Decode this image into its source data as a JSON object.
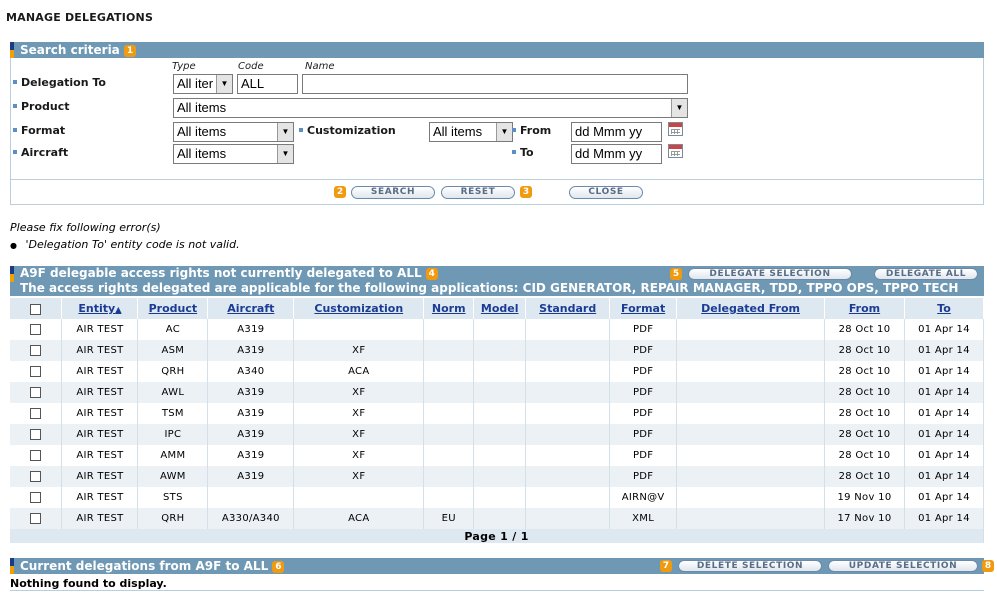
{
  "page": {
    "title": "MANAGE DELEGATIONS"
  },
  "search": {
    "header": "Search criteria",
    "badge": "1",
    "col_type": "Type",
    "col_code": "Code",
    "col_name": "Name",
    "delegation_to_label": "Delegation To",
    "type_value": "All iter",
    "code_value": "ALL",
    "name_value": "",
    "product_label": "Product",
    "product_value": "All items",
    "format_label": "Format",
    "format_value": "All items",
    "customization_label": "Customization",
    "customization_value": "All items",
    "from_label": "From",
    "from_value": "dd Mmm yy",
    "aircraft_label": "Aircraft",
    "aircraft_value": "All items",
    "to_label": "To",
    "to_value": "dd Mmm yy",
    "search_badge": "2",
    "search_button": "SEARCH",
    "reset_button": "RESET",
    "reset_badge": "3",
    "close_button": "CLOSE"
  },
  "errors": {
    "title": "Please fix following error(s)",
    "bullet": "●",
    "items": [
      "'Delegation To' entity code is not valid."
    ]
  },
  "delegable": {
    "header": "A9F delegable access rights not currently delegated to ALL",
    "badge": "4",
    "subheader": "The access rights delegated are applicable for the following applications: CID GENERATOR, REPAIR MANAGER, TDD, TPPO OPS, TPPO TECH",
    "buttons_badge": "5",
    "delegate_selection": "DELEGATE SELECTION",
    "delegate_all": "DELEGATE ALL",
    "columns": [
      "Entity",
      "Product",
      "Aircraft",
      "Customization",
      "Norm",
      "Model",
      "Standard",
      "Format",
      "Delegated From",
      "From",
      "To"
    ],
    "sort_icon": "▲",
    "rows": [
      [
        "AIR TEST",
        "AC",
        "A319",
        "",
        "",
        "",
        "",
        "PDF",
        "",
        "28 Oct 10",
        "01 Apr 14"
      ],
      [
        "AIR TEST",
        "ASM",
        "A319",
        "XF",
        "",
        "",
        "",
        "PDF",
        "",
        "28 Oct 10",
        "01 Apr 14"
      ],
      [
        "AIR TEST",
        "QRH",
        "A340",
        "ACA",
        "",
        "",
        "",
        "PDF",
        "",
        "28 Oct 10",
        "01 Apr 14"
      ],
      [
        "AIR TEST",
        "AWL",
        "A319",
        "XF",
        "",
        "",
        "",
        "PDF",
        "",
        "28 Oct 10",
        "01 Apr 14"
      ],
      [
        "AIR TEST",
        "TSM",
        "A319",
        "XF",
        "",
        "",
        "",
        "PDF",
        "",
        "28 Oct 10",
        "01 Apr 14"
      ],
      [
        "AIR TEST",
        "IPC",
        "A319",
        "XF",
        "",
        "",
        "",
        "PDF",
        "",
        "28 Oct 10",
        "01 Apr 14"
      ],
      [
        "AIR TEST",
        "AMM",
        "A319",
        "XF",
        "",
        "",
        "",
        "PDF",
        "",
        "28 Oct 10",
        "01 Apr 14"
      ],
      [
        "AIR TEST",
        "AWM",
        "A319",
        "XF",
        "",
        "",
        "",
        "PDF",
        "",
        "28 Oct 10",
        "01 Apr 14"
      ],
      [
        "AIR TEST",
        "STS",
        "",
        "",
        "",
        "",
        "",
        "AIRN@V",
        "",
        "19 Nov 10",
        "01 Apr 14"
      ],
      [
        "AIR TEST",
        "QRH",
        "A330/A340",
        "ACA",
        "EU",
        "",
        "",
        "XML",
        "",
        "17 Nov 10",
        "01 Apr 14"
      ]
    ],
    "pager": "Page 1 / 1"
  },
  "current": {
    "header": "Current delegations from A9F to ALL",
    "badge": "6",
    "delete_badge": "7",
    "delete_selection": "DELETE SELECTION",
    "update_selection": "UPDATE SELECTION",
    "update_badge": "8",
    "empty_text": "Nothing found to display."
  },
  "colors": {
    "header_bg": "#6e98b4",
    "table_header_bg": "#dde8f1",
    "link_blue": "#1c3c94",
    "badge_orange": "#f09a10"
  }
}
